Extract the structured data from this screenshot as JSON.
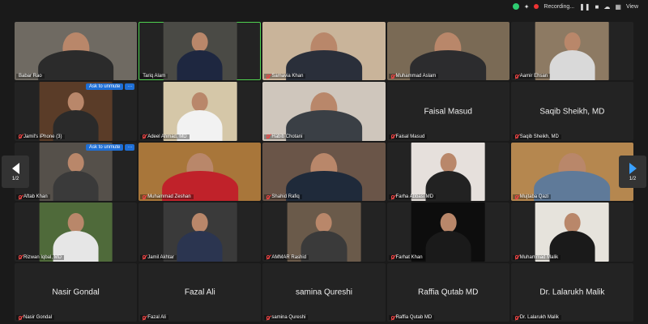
{
  "topbar": {
    "recording_label": "Recording...",
    "view_label": "View"
  },
  "paging": {
    "indicator": "1/2"
  },
  "unmute": {
    "button_label": "Ask to unmute",
    "more_label": "···"
  },
  "tiles": [
    {
      "name": "Babar Rao",
      "muted": false,
      "video": "full",
      "bg": "#6f6a62",
      "shirt": "#2b2b2b"
    },
    {
      "name": "Tariq Alam",
      "muted": false,
      "video": "center",
      "bg": "#4a4a45",
      "shirt": "#1e2740",
      "active": true
    },
    {
      "name": "Samavia Khan",
      "muted": true,
      "video": "full",
      "bg": "#c9b49a",
      "shirt": "#2a2f3a"
    },
    {
      "name": "Muhammad Aslam",
      "muted": true,
      "video": "full",
      "bg": "#7a6a55",
      "shirt": "#2c2c2e"
    },
    {
      "name": "Aamir Ehsan",
      "muted": true,
      "video": "center",
      "bg": "#8d7a63",
      "shirt": "#d9d9d9"
    },
    {
      "name": "Jamil's iPhone (3)",
      "muted": true,
      "video": "center",
      "bg": "#5a3c28",
      "shirt": "#2a2a2a",
      "unmute": true
    },
    {
      "name": "Adeel Ahmad, MD",
      "muted": true,
      "video": "center",
      "bg": "#d5c7a8",
      "shirt": "#f2f2f2"
    },
    {
      "name": "Habib Chotani",
      "muted": true,
      "video": "full",
      "bg": "#cfc6bc",
      "shirt": "#3a3f45"
    },
    {
      "name": "Faisal Masud",
      "muted": true,
      "video": "none",
      "display": "Faisal Masud"
    },
    {
      "name": "Saqib Sheikh, MD",
      "muted": true,
      "video": "none",
      "display": "Saqib Sheikh, MD"
    },
    {
      "name": "Aftab Khan",
      "muted": true,
      "video": "center",
      "bg": "#55504a",
      "shirt": "#3a3a3a",
      "unmute": true
    },
    {
      "name": "Muhammad Zeshan",
      "muted": true,
      "video": "full",
      "bg": "#a8763a",
      "shirt": "#c0222a"
    },
    {
      "name": "Shahid Rafiq",
      "muted": true,
      "video": "full",
      "bg": "#6a5548",
      "shirt": "#1f2a3a"
    },
    {
      "name": "Farha Abbasi MD",
      "muted": true,
      "video": "center",
      "bg": "#e6e0dc",
      "shirt": "#222"
    },
    {
      "name": "Mujtaba Qazi",
      "muted": true,
      "video": "full",
      "bg": "#b5874f",
      "shirt": "#5f7a99"
    },
    {
      "name": "Rizwan Iqbal, MD",
      "muted": true,
      "video": "center",
      "bg": "#4f6a3a",
      "shirt": "#e6e6e6"
    },
    {
      "name": "Jamil Akhtar",
      "muted": true,
      "video": "center",
      "bg": "#3a3a3a",
      "shirt": "#2b3550"
    },
    {
      "name": "AMMAR Rashid",
      "muted": true,
      "video": "center",
      "bg": "#6a5a4a",
      "shirt": "#3a3a3a"
    },
    {
      "name": "Farhat Khan",
      "muted": true,
      "video": "center",
      "bg": "#0d0d0d",
      "shirt": "#1a1a1a"
    },
    {
      "name": "Muhammad Malik",
      "muted": true,
      "video": "center",
      "bg": "#e6e3dc",
      "shirt": "#1a1a1a"
    },
    {
      "name": "Nasir Gondal",
      "muted": true,
      "video": "none",
      "display": "Nasir Gondal"
    },
    {
      "name": "Fazal Ali",
      "muted": true,
      "video": "none",
      "display": "Fazal Ali"
    },
    {
      "name": "samina Qureshi",
      "muted": true,
      "video": "none",
      "display": "samina Qureshi"
    },
    {
      "name": "Raffia Qutab MD",
      "muted": true,
      "video": "none",
      "display": "Raffia Qutab MD"
    },
    {
      "name": "Dr. Lalarukh Malik",
      "muted": true,
      "video": "none",
      "display": "Dr. Lalarukh Malik"
    }
  ]
}
